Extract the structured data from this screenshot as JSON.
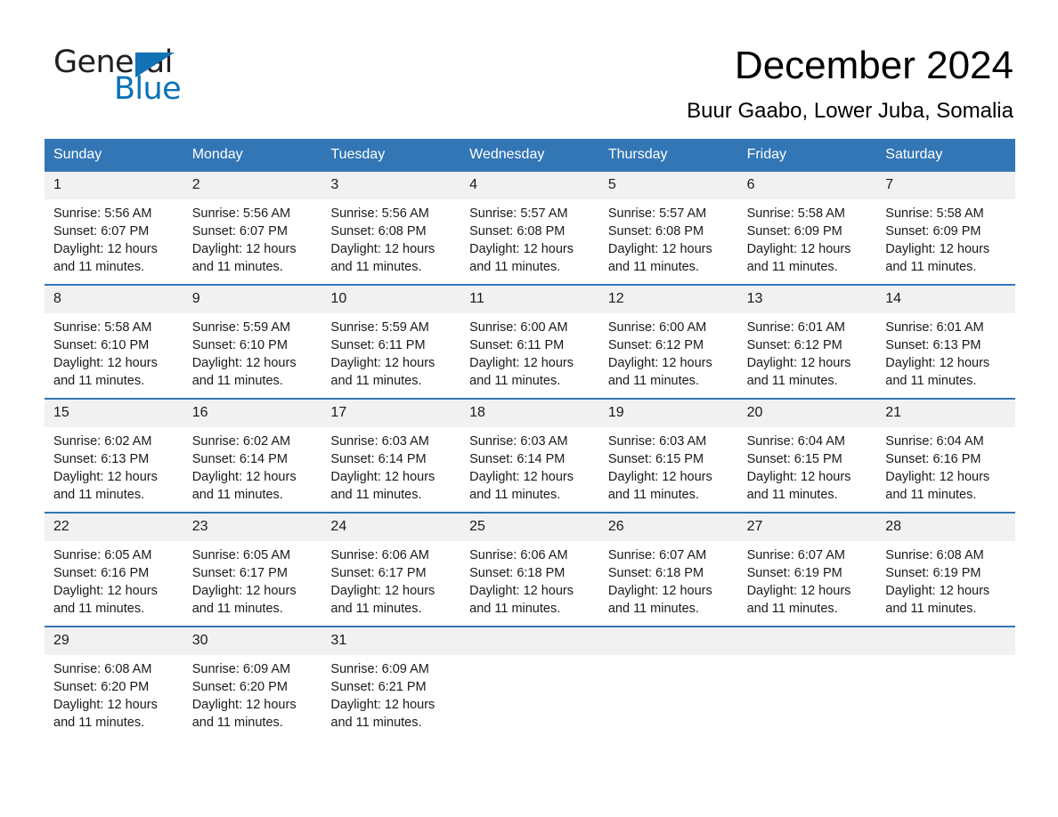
{
  "brand": {
    "name_part1": "General",
    "name_part2": "Blue",
    "triangle_color": "#1272b6",
    "blue_color": "#0a72b8"
  },
  "header": {
    "title": "December 2024",
    "subtitle": "Buur Gaabo, Lower Juba, Somalia"
  },
  "calendar": {
    "header_bg": "#3376b6",
    "daynum_bg": "#f1f1f1",
    "weekday_labels": [
      "Sunday",
      "Monday",
      "Tuesday",
      "Wednesday",
      "Thursday",
      "Friday",
      "Saturday"
    ],
    "weeks": [
      [
        {
          "day": "1",
          "sunrise": "Sunrise: 5:56 AM",
          "sunset": "Sunset: 6:07 PM",
          "daylight_line1": "Daylight: 12 hours",
          "daylight_line2": "and 11 minutes."
        },
        {
          "day": "2",
          "sunrise": "Sunrise: 5:56 AM",
          "sunset": "Sunset: 6:07 PM",
          "daylight_line1": "Daylight: 12 hours",
          "daylight_line2": "and 11 minutes."
        },
        {
          "day": "3",
          "sunrise": "Sunrise: 5:56 AM",
          "sunset": "Sunset: 6:08 PM",
          "daylight_line1": "Daylight: 12 hours",
          "daylight_line2": "and 11 minutes."
        },
        {
          "day": "4",
          "sunrise": "Sunrise: 5:57 AM",
          "sunset": "Sunset: 6:08 PM",
          "daylight_line1": "Daylight: 12 hours",
          "daylight_line2": "and 11 minutes."
        },
        {
          "day": "5",
          "sunrise": "Sunrise: 5:57 AM",
          "sunset": "Sunset: 6:08 PM",
          "daylight_line1": "Daylight: 12 hours",
          "daylight_line2": "and 11 minutes."
        },
        {
          "day": "6",
          "sunrise": "Sunrise: 5:58 AM",
          "sunset": "Sunset: 6:09 PM",
          "daylight_line1": "Daylight: 12 hours",
          "daylight_line2": "and 11 minutes."
        },
        {
          "day": "7",
          "sunrise": "Sunrise: 5:58 AM",
          "sunset": "Sunset: 6:09 PM",
          "daylight_line1": "Daylight: 12 hours",
          "daylight_line2": "and 11 minutes."
        }
      ],
      [
        {
          "day": "8",
          "sunrise": "Sunrise: 5:58 AM",
          "sunset": "Sunset: 6:10 PM",
          "daylight_line1": "Daylight: 12 hours",
          "daylight_line2": "and 11 minutes."
        },
        {
          "day": "9",
          "sunrise": "Sunrise: 5:59 AM",
          "sunset": "Sunset: 6:10 PM",
          "daylight_line1": "Daylight: 12 hours",
          "daylight_line2": "and 11 minutes."
        },
        {
          "day": "10",
          "sunrise": "Sunrise: 5:59 AM",
          "sunset": "Sunset: 6:11 PM",
          "daylight_line1": "Daylight: 12 hours",
          "daylight_line2": "and 11 minutes."
        },
        {
          "day": "11",
          "sunrise": "Sunrise: 6:00 AM",
          "sunset": "Sunset: 6:11 PM",
          "daylight_line1": "Daylight: 12 hours",
          "daylight_line2": "and 11 minutes."
        },
        {
          "day": "12",
          "sunrise": "Sunrise: 6:00 AM",
          "sunset": "Sunset: 6:12 PM",
          "daylight_line1": "Daylight: 12 hours",
          "daylight_line2": "and 11 minutes."
        },
        {
          "day": "13",
          "sunrise": "Sunrise: 6:01 AM",
          "sunset": "Sunset: 6:12 PM",
          "daylight_line1": "Daylight: 12 hours",
          "daylight_line2": "and 11 minutes."
        },
        {
          "day": "14",
          "sunrise": "Sunrise: 6:01 AM",
          "sunset": "Sunset: 6:13 PM",
          "daylight_line1": "Daylight: 12 hours",
          "daylight_line2": "and 11 minutes."
        }
      ],
      [
        {
          "day": "15",
          "sunrise": "Sunrise: 6:02 AM",
          "sunset": "Sunset: 6:13 PM",
          "daylight_line1": "Daylight: 12 hours",
          "daylight_line2": "and 11 minutes."
        },
        {
          "day": "16",
          "sunrise": "Sunrise: 6:02 AM",
          "sunset": "Sunset: 6:14 PM",
          "daylight_line1": "Daylight: 12 hours",
          "daylight_line2": "and 11 minutes."
        },
        {
          "day": "17",
          "sunrise": "Sunrise: 6:03 AM",
          "sunset": "Sunset: 6:14 PM",
          "daylight_line1": "Daylight: 12 hours",
          "daylight_line2": "and 11 minutes."
        },
        {
          "day": "18",
          "sunrise": "Sunrise: 6:03 AM",
          "sunset": "Sunset: 6:14 PM",
          "daylight_line1": "Daylight: 12 hours",
          "daylight_line2": "and 11 minutes."
        },
        {
          "day": "19",
          "sunrise": "Sunrise: 6:03 AM",
          "sunset": "Sunset: 6:15 PM",
          "daylight_line1": "Daylight: 12 hours",
          "daylight_line2": "and 11 minutes."
        },
        {
          "day": "20",
          "sunrise": "Sunrise: 6:04 AM",
          "sunset": "Sunset: 6:15 PM",
          "daylight_line1": "Daylight: 12 hours",
          "daylight_line2": "and 11 minutes."
        },
        {
          "day": "21",
          "sunrise": "Sunrise: 6:04 AM",
          "sunset": "Sunset: 6:16 PM",
          "daylight_line1": "Daylight: 12 hours",
          "daylight_line2": "and 11 minutes."
        }
      ],
      [
        {
          "day": "22",
          "sunrise": "Sunrise: 6:05 AM",
          "sunset": "Sunset: 6:16 PM",
          "daylight_line1": "Daylight: 12 hours",
          "daylight_line2": "and 11 minutes."
        },
        {
          "day": "23",
          "sunrise": "Sunrise: 6:05 AM",
          "sunset": "Sunset: 6:17 PM",
          "daylight_line1": "Daylight: 12 hours",
          "daylight_line2": "and 11 minutes."
        },
        {
          "day": "24",
          "sunrise": "Sunrise: 6:06 AM",
          "sunset": "Sunset: 6:17 PM",
          "daylight_line1": "Daylight: 12 hours",
          "daylight_line2": "and 11 minutes."
        },
        {
          "day": "25",
          "sunrise": "Sunrise: 6:06 AM",
          "sunset": "Sunset: 6:18 PM",
          "daylight_line1": "Daylight: 12 hours",
          "daylight_line2": "and 11 minutes."
        },
        {
          "day": "26",
          "sunrise": "Sunrise: 6:07 AM",
          "sunset": "Sunset: 6:18 PM",
          "daylight_line1": "Daylight: 12 hours",
          "daylight_line2": "and 11 minutes."
        },
        {
          "day": "27",
          "sunrise": "Sunrise: 6:07 AM",
          "sunset": "Sunset: 6:19 PM",
          "daylight_line1": "Daylight: 12 hours",
          "daylight_line2": "and 11 minutes."
        },
        {
          "day": "28",
          "sunrise": "Sunrise: 6:08 AM",
          "sunset": "Sunset: 6:19 PM",
          "daylight_line1": "Daylight: 12 hours",
          "daylight_line2": "and 11 minutes."
        }
      ],
      [
        {
          "day": "29",
          "sunrise": "Sunrise: 6:08 AM",
          "sunset": "Sunset: 6:20 PM",
          "daylight_line1": "Daylight: 12 hours",
          "daylight_line2": "and 11 minutes."
        },
        {
          "day": "30",
          "sunrise": "Sunrise: 6:09 AM",
          "sunset": "Sunset: 6:20 PM",
          "daylight_line1": "Daylight: 12 hours",
          "daylight_line2": "and 11 minutes."
        },
        {
          "day": "31",
          "sunrise": "Sunrise: 6:09 AM",
          "sunset": "Sunset: 6:21 PM",
          "daylight_line1": "Daylight: 12 hours",
          "daylight_line2": "and 11 minutes."
        },
        {
          "day": "",
          "sunrise": "",
          "sunset": "",
          "daylight_line1": "",
          "daylight_line2": ""
        },
        {
          "day": "",
          "sunrise": "",
          "sunset": "",
          "daylight_line1": "",
          "daylight_line2": ""
        },
        {
          "day": "",
          "sunrise": "",
          "sunset": "",
          "daylight_line1": "",
          "daylight_line2": ""
        },
        {
          "day": "",
          "sunrise": "",
          "sunset": "",
          "daylight_line1": "",
          "daylight_line2": ""
        }
      ]
    ]
  }
}
